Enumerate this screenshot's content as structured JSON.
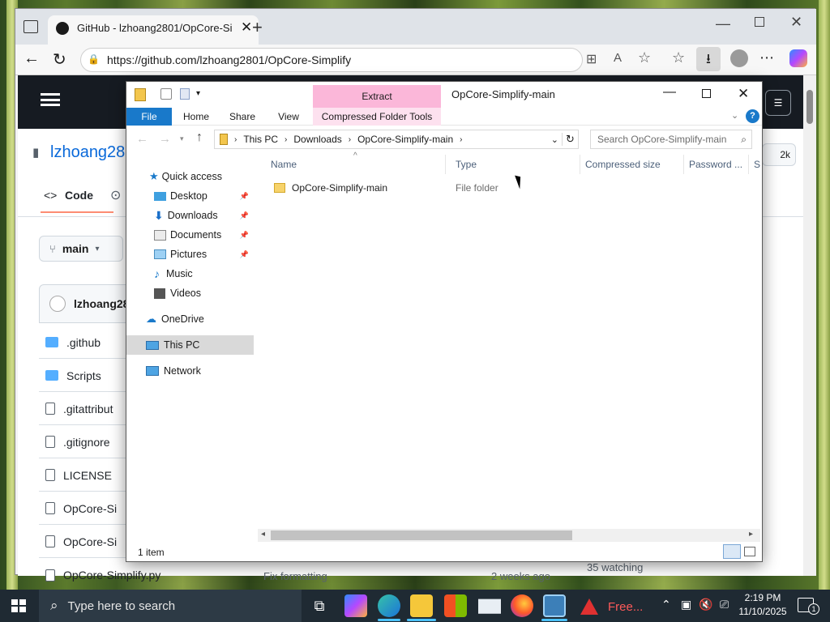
{
  "browser": {
    "tab_title": "GitHub - lzhoang2801/OpCore-Si",
    "url": "https://github.com/lzhoang2801/OpCore-Simplify"
  },
  "github": {
    "repo_owner": "lzhoang28",
    "nav_code": "Code",
    "branch": "main",
    "commit_author": "lzhoang28",
    "files": [
      ".github",
      "Scripts",
      ".gitattribut",
      ".gitignore",
      "LICENSE",
      "OpCore-Si",
      "OpCore-Si",
      "OpCore-Simplify.py"
    ],
    "last_commit_msg": "Fix formatting",
    "last_commit_time": "2 weeks ago",
    "watching": "35 watching",
    "stars": "2k"
  },
  "explorer": {
    "title": "OpCore-Simplify-main",
    "context_tab": "Extract",
    "ribbon_tabs": [
      "File",
      "Home",
      "Share",
      "View",
      "Compressed Folder Tools"
    ],
    "breadcrumb": [
      "This PC",
      "Downloads",
      "OpCore-Simplify-main"
    ],
    "search_placeholder": "Search OpCore-Simplify-main",
    "columns": [
      "Name",
      "Type",
      "Compressed size",
      "Password ...",
      "Si"
    ],
    "items": [
      {
        "name": "OpCore-Simplify-main",
        "type": "File folder"
      }
    ],
    "nav": {
      "quick_access": "Quick access",
      "pinned": [
        "Desktop",
        "Downloads",
        "Documents",
        "Pictures"
      ],
      "others": [
        "Music",
        "Videos"
      ],
      "onedrive": "OneDrive",
      "this_pc": "This PC",
      "network": "Network"
    },
    "status": "1 item"
  },
  "taskbar": {
    "search_placeholder": "Type here to search",
    "app_label": "Free...",
    "time": "2:19 PM",
    "date": "11/10/2025",
    "notification_count": "1"
  },
  "colors": {
    "explorer_accent": "#1979ca",
    "extract_tab": "#fbb7d9",
    "selected_nav": "#d9d9d9",
    "taskbar": "#1f2a33"
  }
}
